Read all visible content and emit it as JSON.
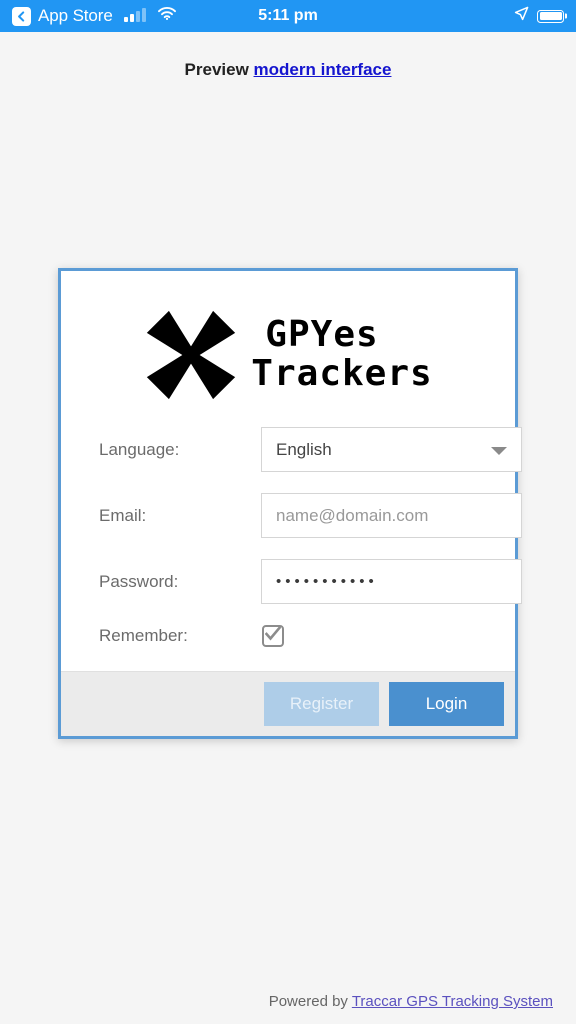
{
  "status_bar": {
    "back_label": "App Store",
    "time": "5:11 pm",
    "back_icon": "chevron-left-icon",
    "signal_icon": "cellular-signal-icon",
    "wifi_icon": "wifi-icon",
    "location_icon": "location-arrow-icon",
    "battery_icon": "battery-full-icon",
    "background_color": "#2196f3"
  },
  "preview_banner": {
    "prefix": "Preview",
    "link_label": "modern interface",
    "link_color": "#1515cf"
  },
  "login_card": {
    "border_color": "#5b9bd5",
    "logo": {
      "mark_icon": "gpyes-x-logo-icon",
      "line1": "GPYes",
      "line2": "Trackers"
    },
    "fields": {
      "language": {
        "label": "Language:",
        "value": "English",
        "arrow_icon": "chevron-down-icon"
      },
      "email": {
        "label": "Email:",
        "value": "",
        "placeholder": "name@domain.com"
      },
      "password": {
        "label": "Password:",
        "value": "•••••••••••",
        "masked_length": 11
      },
      "remember": {
        "label": "Remember:",
        "checked": true,
        "check_icon": "checkmark-icon"
      }
    },
    "actions": {
      "register_label": "Register",
      "register_color": "#aecde8",
      "login_label": "Login",
      "login_color": "#4a90cf"
    }
  },
  "page_footer": {
    "prefix": "Powered by",
    "link_label": "Traccar GPS Tracking System",
    "link_color": "#5b51bf"
  }
}
